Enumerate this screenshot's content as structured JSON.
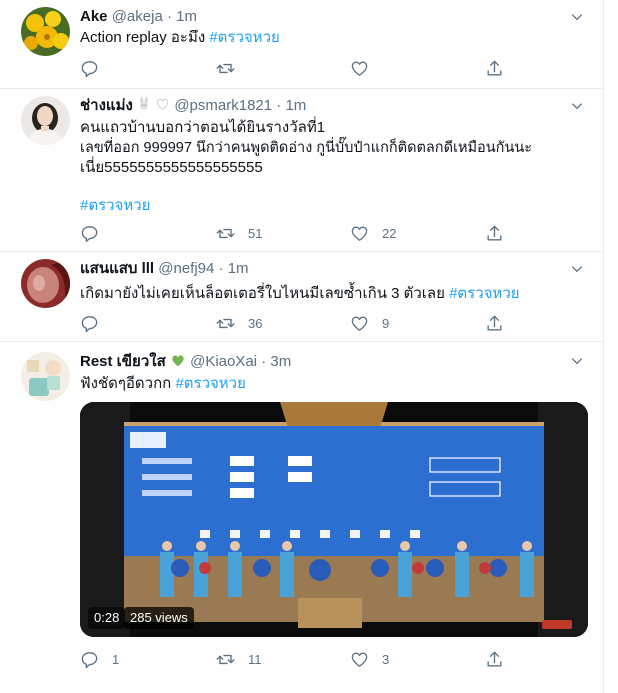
{
  "colors": {
    "accent": "#1da1f2",
    "muted": "#5b7083",
    "text": "#0f1419",
    "border": "#e6ecf0",
    "heart_green": "#77b255"
  },
  "icons": {
    "reply": "reply-icon",
    "retweet": "retweet-icon",
    "like": "heart-icon",
    "share": "share-icon",
    "more": "chevron-down-icon"
  },
  "tweets": [
    {
      "name": "Ake",
      "handle": "@akeja",
      "dot": "·",
      "time": "1m",
      "text": "Action replay อะมึง ",
      "hashtag": "#ตรวจหวย",
      "replies": "",
      "retweets": "",
      "likes": ""
    },
    {
      "name": "ช่างแม่ง",
      "handle": "@psmark1821",
      "dot": "·",
      "time": "1m",
      "line1": "คนแถวบ้านบอกว่าตอนได้ยินรางวัลที่1",
      "line2": "เลขที่ออก 999997 นึกว่าคนพูดติดอ่าง กูนี่บั๊บป๋าแกก็ติดตลกดีเหมือนกันนะ",
      "line3": "เนี่ย5555555555555555555",
      "hashtag": "#ตรวจหวย",
      "replies": "",
      "retweets": "51",
      "likes": "22"
    },
    {
      "name": "แสนแสบ lll",
      "handle": "@nefj94",
      "dot": "·",
      "time": "1m",
      "text": "เกิดมายังไม่เคยเห็นล็อตเตอรี่ใบไหนมีเลขซ้ำเกิน 3 ตัวเลย ",
      "hashtag": "#ตรวจหวย",
      "replies": "",
      "retweets": "36",
      "likes": "9"
    },
    {
      "name": "Rest เขียวใส",
      "handle": "@KiaoXai",
      "dot": "·",
      "time": "3m",
      "text": "ฟังชัดๆอีดวกก ",
      "hashtag": "#ตรวจหวย",
      "replies": "1",
      "retweets": "11",
      "likes": "3",
      "video_duration": "0:28",
      "video_views": "285 views"
    }
  ]
}
